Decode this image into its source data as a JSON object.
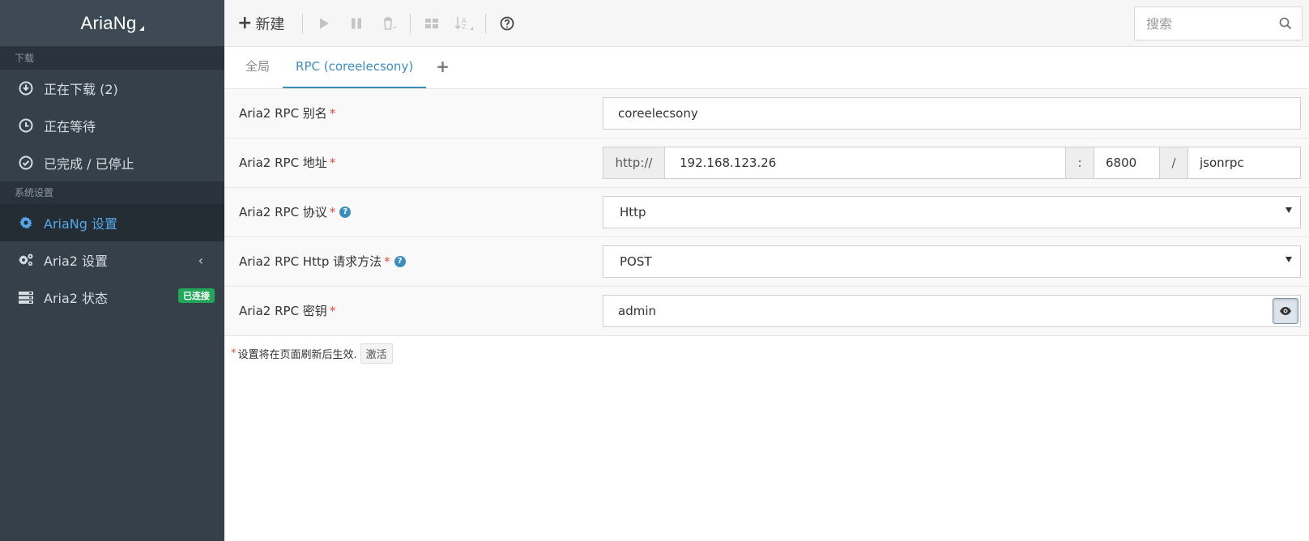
{
  "app": {
    "title": "AriaNg"
  },
  "sidebar": {
    "sections": [
      {
        "header": "下载",
        "items": [
          {
            "label": "正在下载 (2)",
            "icon": "download-circle-icon"
          },
          {
            "label": "正在等待",
            "icon": "clock-icon"
          },
          {
            "label": "已完成 / 已停止",
            "icon": "check-circle-icon"
          }
        ]
      },
      {
        "header": "系统设置",
        "items": [
          {
            "label": "AriaNg 设置",
            "icon": "gear-icon",
            "active": true
          },
          {
            "label": "Aria2 设置",
            "icon": "gears-icon"
          },
          {
            "label": "Aria2 状态",
            "icon": "server-icon",
            "badge": "已连接"
          }
        ]
      }
    ]
  },
  "toolbar": {
    "new_label": "新建",
    "search_placeholder": "搜索"
  },
  "tabs": [
    {
      "label": "全局",
      "active": false
    },
    {
      "label": "RPC (coreelecsony)",
      "active": true
    }
  ],
  "form": {
    "rows": [
      {
        "label": "Aria2 RPC 别名",
        "value": "coreelecsony"
      },
      {
        "label": "Aria2 RPC 地址",
        "protocol_prefix": "http://",
        "host": "192.168.123.26",
        "port_sep": ":",
        "port": "6800",
        "path_sep": "/",
        "path": "jsonrpc"
      },
      {
        "label": "Aria2 RPC 协议",
        "value": "Http"
      },
      {
        "label": "Aria2 RPC Http 请求方法",
        "value": "POST"
      },
      {
        "label": "Aria2 RPC 密钥",
        "value": "admin"
      }
    ],
    "required_mark": "*"
  },
  "note": {
    "text": "设置将在页面刷新后生效.",
    "button": "激活"
  },
  "colors": {
    "sidebar_bg": "#354049",
    "accent": "#3c8dbc",
    "badge_green": "#22a65a",
    "required_red": "#dd4b39"
  }
}
